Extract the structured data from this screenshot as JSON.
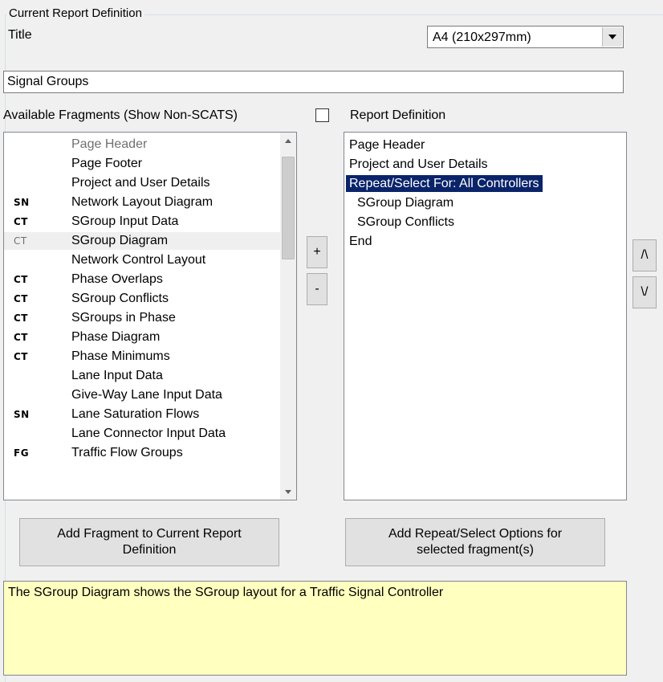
{
  "group": {
    "legend": "Current Report Definition"
  },
  "title_label": "Title",
  "paper_size": {
    "selected": "A4 (210x297mm)"
  },
  "title_value": "Signal Groups",
  "available_label": "Available Fragments (Show Non-SCATS)",
  "report_label": "Report Definition",
  "fragments": [
    {
      "code": "",
      "label": "Page Header",
      "grey": true
    },
    {
      "code": "",
      "label": "Page Footer"
    },
    {
      "code": "",
      "label": "Project and User Details"
    },
    {
      "code": "SN",
      "label": "Network Layout Diagram"
    },
    {
      "code": "CT",
      "label": "SGroup Input Data"
    },
    {
      "code": "CT",
      "label": "SGroup Diagram",
      "grey_code": true,
      "highlight": true
    },
    {
      "code": "",
      "label": "Network Control Layout"
    },
    {
      "code": "CT",
      "label": "Phase Overlaps"
    },
    {
      "code": "CT",
      "label": "SGroup Conflicts"
    },
    {
      "code": "CT",
      "label": "SGroups in Phase"
    },
    {
      "code": "CT",
      "label": "Phase Diagram"
    },
    {
      "code": "CT",
      "label": "Phase Minimums"
    },
    {
      "code": "",
      "label": "Lane Input Data"
    },
    {
      "code": "",
      "label": "Give-Way Lane Input Data"
    },
    {
      "code": "SN",
      "label": "Lane Saturation Flows"
    },
    {
      "code": "",
      "label": "Lane Connector Input Data"
    },
    {
      "code": "FG",
      "label": "Traffic Flow Groups"
    }
  ],
  "report_items": [
    {
      "label": "Page Header"
    },
    {
      "label": "Project and User Details"
    },
    {
      "label": "Repeat/Select For: All Controllers",
      "selected": true
    },
    {
      "label": "SGroup Diagram",
      "indent": true
    },
    {
      "label": "SGroup Conflicts",
      "indent": true
    },
    {
      "label": "End"
    }
  ],
  "buttons": {
    "add": "+",
    "remove": "-",
    "move_up": "/\\",
    "move_down": "\\/",
    "add_fragment": "Add Fragment to Current Report Definition",
    "add_repeat": "Add Repeat/Select Options for selected fragment(s)"
  },
  "description": "The SGroup Diagram shows the SGroup layout for a Traffic Signal Controller",
  "colors": {
    "selection": "#0a246a",
    "description_bg": "#ffffc0"
  }
}
